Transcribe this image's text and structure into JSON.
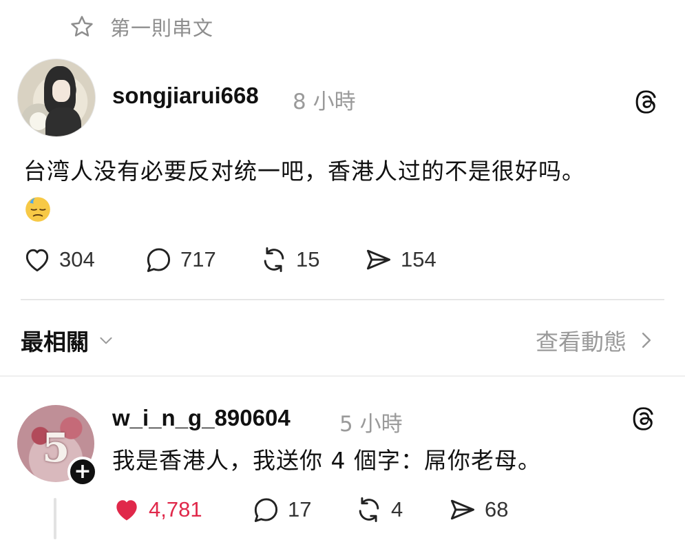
{
  "header": {
    "first_thread_label": "第一則串文",
    "star_icon": "star-icon"
  },
  "post": {
    "username": "songjiarui668",
    "time": "8 小時",
    "text": "台湾人没有必要反对统一吧，香港人过的不是很好吗。",
    "emoji": "downcast-face-with-sweat",
    "likes": "304",
    "replies": "717",
    "reposts": "15",
    "shares": "154"
  },
  "sort": {
    "label": "最相關",
    "view_activity": "查看動態"
  },
  "reply": {
    "username": "w_i_n_g_890604",
    "time": "5 小時",
    "text": "我是香港人，我送你 4 個字：屌你老母。",
    "likes": "4,781",
    "replies": "17",
    "reposts": "4",
    "shares": "68",
    "liked": true
  },
  "colors": {
    "like_active": "#e0284a",
    "muted": "#9a9a9a",
    "text": "#111111"
  }
}
